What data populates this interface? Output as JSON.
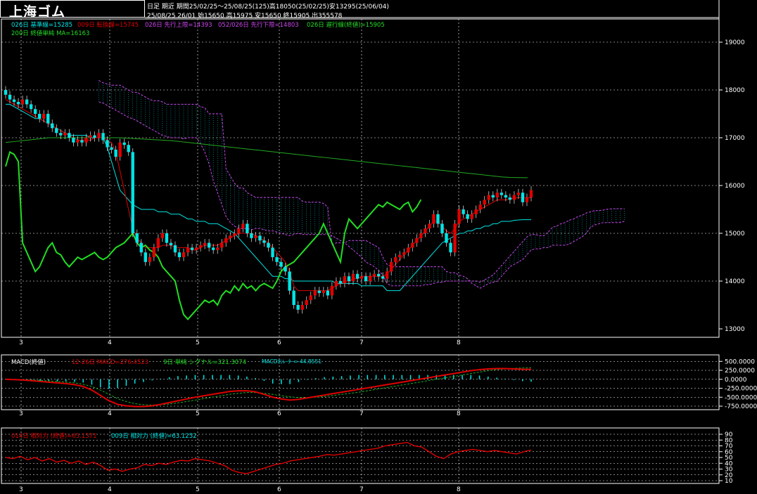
{
  "title": "上海ゴム",
  "header": {
    "line1": "日足 期近 期間25/02/25～25/08/25(125)高18050(25/02/25)安13295(25/06/04)",
    "line2": "25/08/25 26/01 始15650 高15975 安15650 終15905 出355578"
  },
  "main_legend": {
    "kijun": "026日 基準線=15285",
    "tenkan": "009日 転換線=15745",
    "senkou1": "026日 先行上限=14393",
    "senkou2": "052/026日 先行下限=14803",
    "chikou": "026日 遅行線(終値)=15905",
    "ma": "200日 終値単純 MA=16163"
  },
  "macd_legend": {
    "label": "MACD(終値)",
    "macd": "12-26日 MACD=276.4523",
    "signal": "9日 単純 シグナル=321.3074",
    "osc": "MACDｵｼﾚｰﾀｰ=-44.8551"
  },
  "rsi_legend": {
    "rsi14": "014日 相対力 (終値)=63.1371",
    "rsi9": "009日 相対力 (終値)=63.1252"
  },
  "colors": {
    "kijun": "#00e5e5",
    "tenkan": "#e00000",
    "senkou": "#cc44ee",
    "chikou": "#22dd22",
    "ma": "#22aa22",
    "up": "#e00000",
    "down": "#00e5e5",
    "macd": "#e00000",
    "signal": "#22aa22",
    "rsi": "#e00000"
  },
  "x_ticks": [
    "3",
    "4",
    "5",
    "6",
    "7",
    "8"
  ],
  "main_ticks": [
    "19000",
    "18000",
    "17000",
    "16000",
    "15000",
    "14000",
    "13000"
  ],
  "macd_ticks": [
    "500.0000",
    "250.0000",
    "0.0000",
    "-250.0000",
    "-500.0000",
    "-750.0000"
  ],
  "rsi_ticks": [
    "90",
    "80",
    "70",
    "60",
    "50",
    "40",
    "30",
    "20",
    "10"
  ],
  "chart_data": [
    {
      "type": "candlestick",
      "y_range": [
        13000,
        19000
      ],
      "x_months": [
        "3",
        "4",
        "5",
        "6",
        "7",
        "8"
      ],
      "closes": [
        17900,
        17800,
        17750,
        17700,
        17800,
        17700,
        17600,
        17500,
        17400,
        17500,
        17300,
        17200,
        17100,
        17050,
        17100,
        17000,
        16900,
        16950,
        16900,
        17000,
        17050,
        17000,
        17100,
        16950,
        16800,
        16750,
        16600,
        16900,
        16850,
        16700,
        15000,
        14800,
        14600,
        14400,
        14500,
        14700,
        14900,
        15000,
        14800,
        14750,
        14600,
        14500,
        14600,
        14700,
        14650,
        14700,
        14750,
        14800,
        14700,
        14650,
        14700,
        14800,
        14900,
        14950,
        15000,
        15100,
        15200,
        15000,
        14900,
        14950,
        14850,
        14800,
        14700,
        14500,
        14400,
        14300,
        14200,
        13800,
        13500,
        13400,
        13500,
        13600,
        13700,
        13800,
        13750,
        13800,
        13700,
        13900,
        14000,
        13950,
        14100,
        14000,
        14150,
        14050,
        14100,
        14000,
        14100,
        14150,
        14100,
        14050,
        14200,
        14400,
        14500,
        14550,
        14600,
        14700,
        14800,
        14900,
        15000,
        15100,
        15200,
        15400,
        15200,
        15000,
        14800,
        14600,
        15200,
        15500,
        15400,
        15300,
        15400,
        15500,
        15600,
        15700,
        15800,
        15750,
        15850,
        15800,
        15750,
        15700,
        15800,
        15850,
        15650,
        15750,
        15905
      ],
      "tenkan": [
        17800,
        17750,
        17700,
        17650,
        17600,
        17550,
        17500,
        17450,
        17400,
        17350,
        17300,
        17250,
        17200,
        17150,
        17100,
        17050,
        17000,
        16950,
        16950,
        16950,
        16950,
        17000,
        17000,
        17000,
        16950,
        16900,
        16700,
        16300,
        15900,
        15500,
        15100,
        14900,
        14800,
        14700,
        14700,
        14700,
        14700,
        14750,
        14750,
        14750,
        14700,
        14700,
        14700,
        14700,
        14650,
        14650,
        14700,
        14750,
        14750,
        14750,
        14750,
        14800,
        14850,
        14900,
        14950,
        15000,
        15000,
        15000,
        15000,
        14950,
        14900,
        14850,
        14800,
        14700,
        14600,
        14500,
        14400,
        14200,
        13900,
        13800,
        13800,
        13800,
        13800,
        13800,
        13800,
        13800,
        13800,
        13850,
        13900,
        13950,
        14000,
        14000,
        14050,
        14050,
        14100,
        14100,
        14100,
        14100,
        14100,
        14100,
        14150,
        14250,
        14350,
        14450,
        14550,
        14650,
        14750,
        14850,
        14950,
        15050,
        15150,
        15250,
        15250,
        15150,
        15050,
        15000,
        15100,
        15250,
        15300,
        15350,
        15400,
        15450,
        15500,
        15550,
        15600,
        15650,
        15700,
        15700,
        15700,
        15720,
        15740,
        15745,
        15745,
        15745,
        15745
      ],
      "kijun": [
        17700,
        17700,
        17650,
        17600,
        17550,
        17500,
        17450,
        17400,
        17400,
        17350,
        17300,
        17250,
        17200,
        17150,
        17100,
        17050,
        17050,
        17050,
        17050,
        17050,
        17000,
        17000,
        17000,
        17000,
        16800,
        16500,
        16200,
        15900,
        15800,
        15700,
        15600,
        15550,
        15500,
        15500,
        15500,
        15500,
        15450,
        15450,
        15450,
        15400,
        15400,
        15400,
        15350,
        15300,
        15300,
        15250,
        15250,
        15250,
        15200,
        15200,
        15200,
        15150,
        15100,
        15050,
        15000,
        14900,
        14800,
        14700,
        14600,
        14500,
        14400,
        14300,
        14200,
        14100,
        14100,
        14100,
        14050,
        14050,
        14000,
        14000,
        14000,
        14000,
        14000,
        14000,
        14000,
        14000,
        14000,
        14000,
        13950,
        13950,
        13950,
        13950,
        13950,
        13950,
        13900,
        13900,
        13900,
        13900,
        13900,
        13900,
        13800,
        13800,
        13800,
        13800,
        13900,
        14000,
        14100,
        14200,
        14300,
        14400,
        14500,
        14600,
        14700,
        14800,
        14850,
        14900,
        14950,
        15000,
        15000,
        15050,
        15050,
        15100,
        15100,
        15150,
        15150,
        15200,
        15200,
        15250,
        15250,
        15250,
        15270,
        15280,
        15285,
        15285,
        15285
      ],
      "ma200": [
        16900,
        16920,
        16940,
        16960,
        16980,
        17000,
        17000,
        17000,
        17000,
        17000,
        17000,
        17000,
        17000,
        17000,
        16990,
        16980,
        16970,
        16960,
        16950,
        16940,
        16920,
        16900,
        16880,
        16860,
        16840,
        16820,
        16800,
        16780,
        16760,
        16740,
        16720,
        16700,
        16680,
        16660,
        16640,
        16620,
        16600,
        16580,
        16560,
        16540,
        16520,
        16500,
        16480,
        16460,
        16440,
        16420,
        16400,
        16380,
        16360,
        16340,
        16320,
        16300,
        16280,
        16260,
        16240,
        16220,
        16200,
        16180,
        16170,
        16165,
        16163
      ]
    },
    {
      "type": "line",
      "name": "MACD(終値)",
      "y_range": [
        -750,
        500
      ],
      "macd": [
        0,
        -10,
        -20,
        -40,
        -60,
        -80,
        -100,
        -120,
        -150,
        -200,
        -300,
        -450,
        -600,
        -700,
        -740,
        -760,
        -760,
        -740,
        -700,
        -650,
        -600,
        -550,
        -500,
        -460,
        -420,
        -380,
        -340,
        -320,
        -320,
        -350,
        -420,
        -500,
        -550,
        -580,
        -560,
        -520,
        -480,
        -440,
        -400,
        -360,
        -320,
        -280,
        -240,
        -200,
        -160,
        -120,
        -80,
        -40,
        0,
        40,
        80,
        120,
        160,
        200,
        240,
        270,
        290,
        300,
        300,
        290,
        280,
        276
      ],
      "signal": [
        0,
        -5,
        -10,
        -20,
        -30,
        -45,
        -60,
        -80,
        -100,
        -140,
        -200,
        -300,
        -420,
        -540,
        -620,
        -680,
        -710,
        -720,
        -710,
        -690,
        -660,
        -620,
        -580,
        -540,
        -500,
        -460,
        -420,
        -390,
        -370,
        -370,
        -390,
        -420,
        -460,
        -490,
        -510,
        -510,
        -500,
        -480,
        -450,
        -420,
        -390,
        -360,
        -320,
        -280,
        -240,
        -200,
        -160,
        -120,
        -80,
        -40,
        0,
        40,
        80,
        120,
        160,
        200,
        240,
        270,
        290,
        305,
        315,
        321
      ]
    },
    {
      "type": "line",
      "name": "相対力",
      "y_range": [
        10,
        90
      ],
      "rsi": [
        50,
        48,
        52,
        46,
        50,
        44,
        48,
        42,
        45,
        40,
        44,
        38,
        42,
        36,
        28,
        30,
        26,
        30,
        32,
        38,
        36,
        40,
        38,
        42,
        45,
        44,
        48,
        46,
        44,
        40,
        36,
        28,
        24,
        22,
        26,
        30,
        34,
        38,
        40,
        44,
        46,
        48,
        50,
        52,
        55,
        54,
        56,
        58,
        60,
        62,
        64,
        66,
        70,
        72,
        74,
        76,
        70,
        68,
        60,
        52,
        48,
        56,
        60,
        62,
        64,
        62,
        60,
        62,
        60,
        58,
        56,
        60,
        63
      ]
    }
  ]
}
